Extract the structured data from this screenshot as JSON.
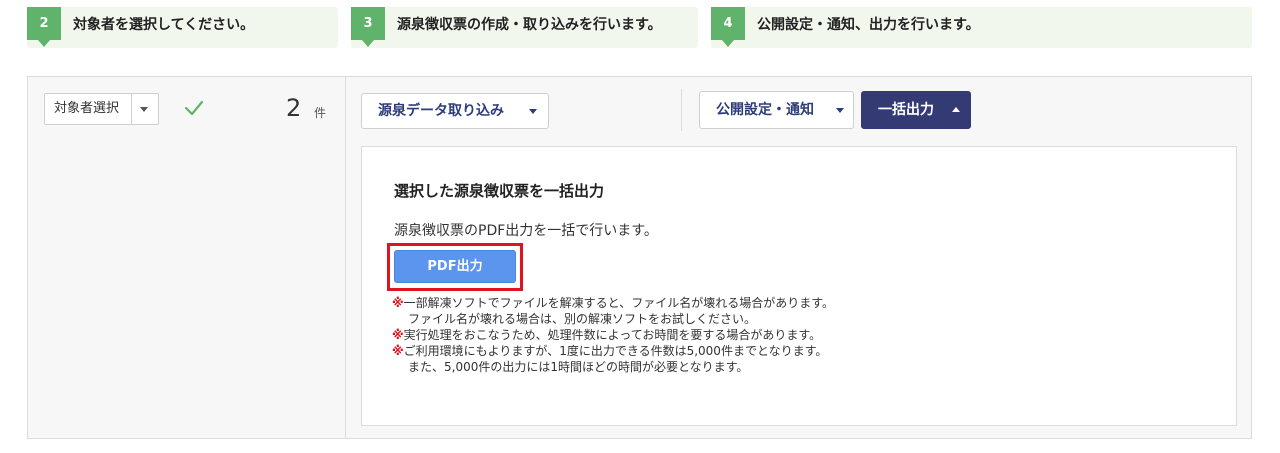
{
  "steps": [
    {
      "number": "2",
      "text": "対象者を選択してください。"
    },
    {
      "number": "3",
      "text": "源泉徴収票の作成・取り込みを行います。"
    },
    {
      "number": "4",
      "text": "公開設定・通知、出力を行います。"
    }
  ],
  "left_panel": {
    "select_label": "対象者選択",
    "count": "2",
    "count_unit": "件"
  },
  "toolbar": {
    "import_label": "源泉データ取り込み",
    "publish_label": "公開設定・通知",
    "bulk_output_label": "一括出力"
  },
  "bulk_output": {
    "title": "選択した源泉徴収票を一括出力",
    "description": "源泉徴収票のPDF出力を一括で行います。",
    "pdf_button": "PDF出力",
    "note_mark": "※",
    "notes": [
      "一部解凍ソフトでファイルを解凍すると、ファイル名が壊れる場合があります。",
      "ファイル名が壊れる場合は、別の解凍ソフトをお試しください。",
      "実行処理をおこなうため、処理件数によってお時間を要する場合があります。",
      "ご利用環境にもよりますが、1度に出力できる件数は5,000件までとなります。",
      "また、5,000件の出力には1時間ほどの時間が必要となります。"
    ]
  },
  "colors": {
    "step_green": "#5fb36a",
    "step_bg": "#f2f7ee",
    "dark_button": "#343a73",
    "pdf_button": "#5b95ee",
    "highlight_red": "#e0141e",
    "check_green": "#5fb36a"
  },
  "icons": {
    "check": "check-icon",
    "dropdown": "chevron-down-icon",
    "dropup": "chevron-up-icon"
  }
}
